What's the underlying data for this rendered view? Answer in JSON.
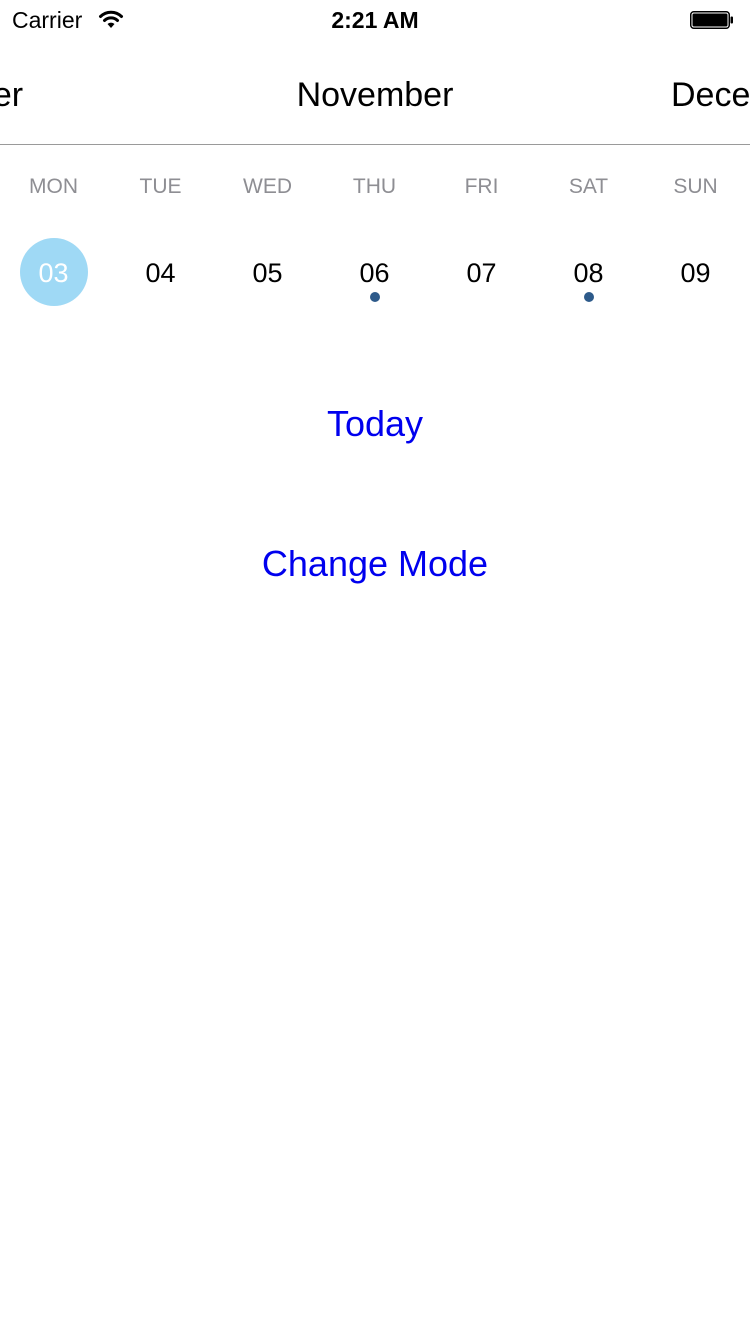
{
  "status_bar": {
    "carrier": "Carrier",
    "time": "2:21 AM"
  },
  "months": {
    "previous": "October",
    "previous_visible": "ober",
    "current": "November",
    "next": "December",
    "next_visible": "Dece"
  },
  "weekdays": [
    "MON",
    "TUE",
    "WED",
    "THU",
    "FRI",
    "SAT",
    "SUN"
  ],
  "days": [
    {
      "label": "03",
      "selected": true,
      "has_event": false
    },
    {
      "label": "04",
      "selected": false,
      "has_event": false
    },
    {
      "label": "05",
      "selected": false,
      "has_event": false
    },
    {
      "label": "06",
      "selected": false,
      "has_event": true
    },
    {
      "label": "07",
      "selected": false,
      "has_event": false
    },
    {
      "label": "08",
      "selected": false,
      "has_event": true
    },
    {
      "label": "09",
      "selected": false,
      "has_event": false
    }
  ],
  "buttons": {
    "today": "Today",
    "change_mode": "Change Mode"
  },
  "colors": {
    "selected_day": "#9fd9f5",
    "event_dot": "#2d5a8a",
    "link": "#0000ee",
    "weekday_text": "#8e8e93"
  }
}
